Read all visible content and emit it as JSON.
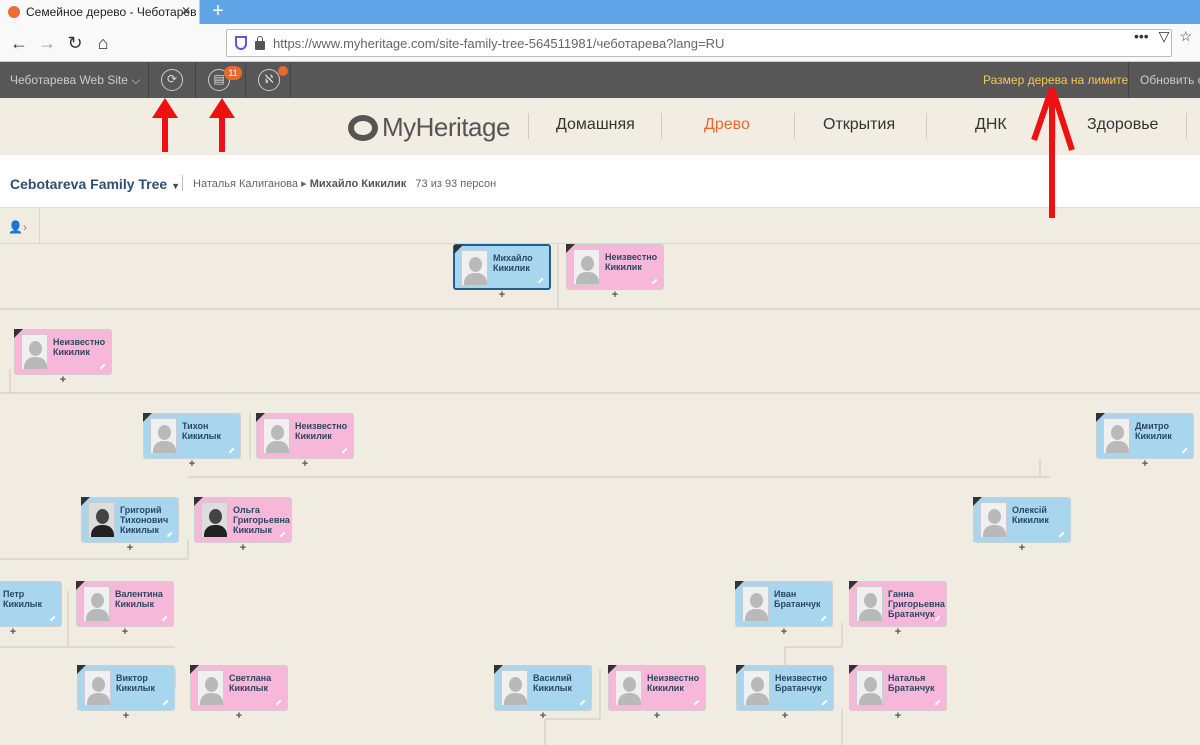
{
  "browser": {
    "tab_title": "Семейное дерево - Чеботарев",
    "url": "https://www.myheritage.com/site-family-tree-564511981/чеботарева?lang=RU"
  },
  "topbar": {
    "site": "Чеботарева Web Site",
    "badge": "11",
    "tree_size": "Размер дерева на лимите",
    "update": "Обновить се"
  },
  "brand": {
    "logo": "MyHeritage"
  },
  "nav": [
    "Домашняя",
    "Древо",
    "Открытия",
    "ДНК",
    "Здоровье"
  ],
  "crumb": {
    "tree": "Cebotareva Family Tree",
    "path1": "Наталья Калиганова",
    "path2": "Михайло Кикилик",
    "count": "73 из 93 персон"
  },
  "persons": [
    {
      "name": "Михайло Кикилик",
      "sex": "m"
    },
    {
      "name": "Неизвестно Кикилик",
      "sex": "f"
    },
    {
      "name": "Неизвестно Кикилик",
      "sex": "f"
    },
    {
      "name": "Тихон Кикилык",
      "sex": "m"
    },
    {
      "name": "Неизвестно Кикилик",
      "sex": "f"
    },
    {
      "name": "Дмитро Кикилик",
      "sex": "m"
    },
    {
      "name": "Григорий Тихонович Кикилык",
      "sex": "m"
    },
    {
      "name": "Ольга Григорьевна Кикилык",
      "sex": "f"
    },
    {
      "name": "Олексій Кикилик",
      "sex": "m"
    },
    {
      "name": "Петр Кикилык",
      "sex": "m"
    },
    {
      "name": "Валентина Кикилык",
      "sex": "f"
    },
    {
      "name": "Иван Братанчук",
      "sex": "m"
    },
    {
      "name": "Ганна Григорьевна Братанчук",
      "sex": "f"
    },
    {
      "name": "Виктор Кикилык",
      "sex": "m"
    },
    {
      "name": "Светлана Кикилык",
      "sex": "f"
    },
    {
      "name": "Василий Кикилык",
      "sex": "m"
    },
    {
      "name": "Неизвестно Кикилик",
      "sex": "f"
    },
    {
      "name": "Неизвестно Братанчук",
      "sex": "m"
    },
    {
      "name": "Наталья Братанчук",
      "sex": "f"
    }
  ]
}
